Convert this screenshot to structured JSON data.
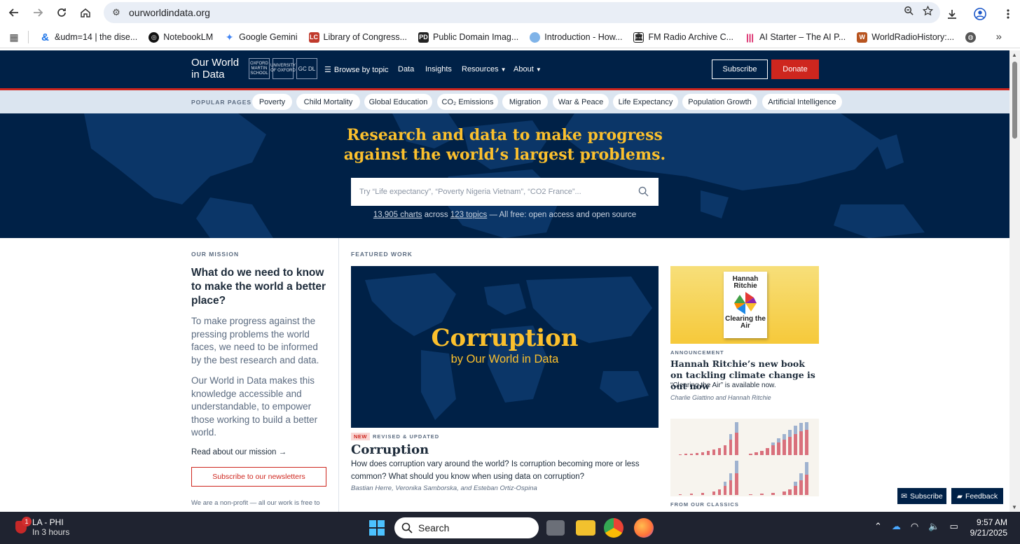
{
  "browser": {
    "url": "ourworldindata.org",
    "bookmarks": [
      {
        "label": "&udm=14 | the dise...",
        "icon": "link-icon"
      },
      {
        "label": "NotebookLM",
        "icon": "notebooklm-icon"
      },
      {
        "label": "Google Gemini",
        "icon": "gemini-icon"
      },
      {
        "label": "Library of Congress...",
        "icon": "loc-icon"
      },
      {
        "label": "Public Domain Imag...",
        "icon": "pd-icon"
      },
      {
        "label": "Introduction - How...",
        "icon": "cloud-icon"
      },
      {
        "label": "FM Radio Archive C...",
        "icon": "archive-icon"
      },
      {
        "label": "AI Starter – The AI P...",
        "icon": "ai-icon"
      },
      {
        "label": "WorldRadioHistory:...",
        "icon": "radio-icon"
      }
    ]
  },
  "header": {
    "logo_line1": "Our World",
    "logo_line2": "in Data",
    "partners": [
      "OXFORD MARTIN SCHOOL",
      "UNIVERSITY OF OXFORD",
      "GC DL"
    ],
    "nav": {
      "browse": "Browse by topic",
      "data": "Data",
      "insights": "Insights",
      "resources": "Resources",
      "about": "About"
    },
    "subscribe": "Subscribe",
    "donate": "Donate"
  },
  "popular": {
    "label": "POPULAR PAGES",
    "items": [
      "Poverty",
      "Child Mortality",
      "Global Education",
      "CO₂ Emissions",
      "Migration",
      "War & Peace",
      "Life Expectancy",
      "Population Growth",
      "Artificial Intelligence"
    ]
  },
  "hero": {
    "title_line1": "Research and data to make progress",
    "title_line2": "against the world’s largest problems.",
    "search_placeholder": "Try “Life expectancy”, “Poverty Nigeria Vietnam”, “CO2 France”...",
    "stats_charts": "13,905 charts",
    "stats_across": " across ",
    "stats_topics": "123 topics",
    "stats_rest": " — All free: open access and open source"
  },
  "mission": {
    "label": "OUR MISSION",
    "question": "What do we need to know to make the world a better place?",
    "p1": "To make progress against the pressing problems the world faces, we need to be informed by the best research and data.",
    "p2": "Our World in Data makes this knowledge accessible and understandable, to empower those working to build a better world.",
    "link": "Read about our mission →",
    "newsletter": "Subscribe to our newsletters",
    "nonprofit": "We are a non-profit — all our work is free to"
  },
  "featured": {
    "label": "FEATURED WORK",
    "image_title": "Corruption",
    "image_sub": "by Our World in Data",
    "tag_new": "NEW",
    "tag_rev": "REVISED & UPDATED",
    "title": "Corruption",
    "description": "How does corruption vary around the world? Is corruption becoming more or less common? What should you know when using data on corruption?",
    "authors": "Bastian Herre, Veronika Samborska, and Esteban Ortiz-Ospina"
  },
  "announcement": {
    "book_author": "Hannah Ritchie",
    "book_title": "Clearing the Air",
    "label": "ANNOUNCEMENT",
    "title": "Hannah Ritchie’s new book on tackling climate change is out now",
    "text": "“Clearing the Air” is available now.",
    "authors": "Charlie Giattino and Hannah Ritchie"
  },
  "classics": {
    "label": "FROM OUR CLASSICS"
  },
  "floating": {
    "subscribe": "Subscribe",
    "feedback": "Feedback"
  },
  "taskbar": {
    "weather_title": "LA - PHI",
    "weather_sub": "In 3 hours",
    "notification_count": "1",
    "search": "Search",
    "time": "9:57 AM",
    "date": "9/21/2025"
  },
  "colors": {
    "navy": "#002147",
    "red": "#ce261e",
    "yellow": "#fbc02d"
  }
}
